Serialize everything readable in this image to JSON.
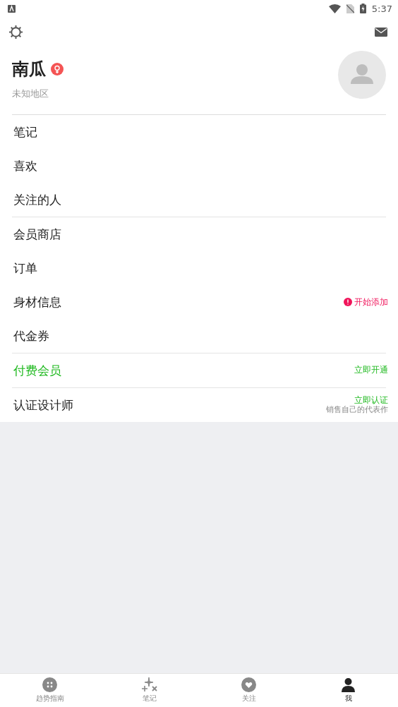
{
  "status_bar": {
    "time": "5:37"
  },
  "profile": {
    "name": "南瓜",
    "badge": {
      "kind": "female"
    },
    "region": "未知地区"
  },
  "menu_groups": [
    {
      "items": [
        {
          "label": "笔记",
          "highlighted": false
        },
        {
          "label": "喜欢",
          "highlighted": false
        },
        {
          "label": "关注的人",
          "highlighted": false
        }
      ]
    },
    {
      "items": [
        {
          "label": "会员商店",
          "highlighted": false
        },
        {
          "label": "订单",
          "highlighted": false
        },
        {
          "label": "身材信息",
          "highlighted": false,
          "trailing": {
            "kind": "alert",
            "text": "开始添加"
          }
        },
        {
          "label": "代金券",
          "highlighted": false
        }
      ]
    },
    {
      "items": [
        {
          "label": "付费会员",
          "highlighted": true,
          "trailing": {
            "kind": "link",
            "text": "立即开通"
          }
        }
      ]
    },
    {
      "items": [
        {
          "label": "认证设计师",
          "highlighted": false,
          "trailing": {
            "kind": "link",
            "text": "立即认证",
            "note": "销售自己的代表作"
          }
        }
      ]
    }
  ],
  "bottom_nav": [
    {
      "label": "趋势指南",
      "kind": "dots",
      "selected": false
    },
    {
      "label": "笔记",
      "kind": "sparkle",
      "selected": false
    },
    {
      "label": "关注",
      "kind": "heart",
      "selected": false
    },
    {
      "label": "我",
      "kind": "person",
      "selected": true
    }
  ]
}
